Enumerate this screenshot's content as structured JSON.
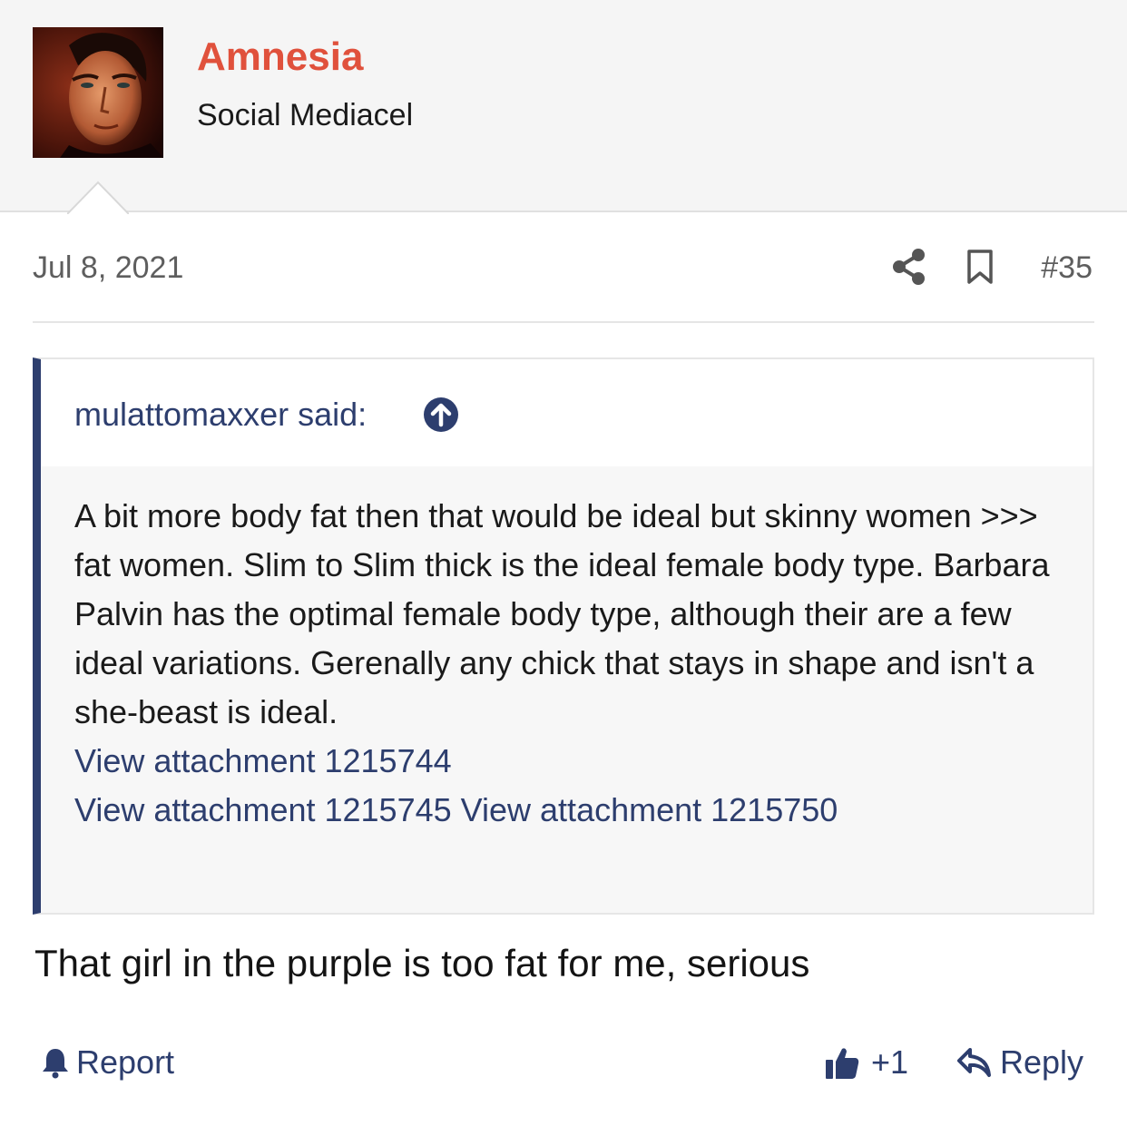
{
  "author": {
    "name": "Amnesia",
    "title": "Social Mediacel"
  },
  "post": {
    "date": "Jul 8, 2021",
    "number": "#35",
    "share_icon": "share-icon",
    "bookmark_icon": "bookmark-icon"
  },
  "quote": {
    "attribution": "mulattomaxxer said:",
    "up_icon": "arrow-up-circle-icon",
    "text": "A bit more body fat then that would be ideal but skinny women >>> fat women. Slim to Slim thick is the ideal female body type. Barbara Palvin has the optimal female body type, although their are a few ideal variations. Gerenally any chick that stays in shape and isn't a she-beast is ideal.",
    "attachments": [
      "View attachment 1215744",
      "View attachment 1215745",
      "View attachment 1215750"
    ]
  },
  "message": "That girl in the purple is too fat for me, serious",
  "actions": {
    "report_label": "Report",
    "like_label": "+1",
    "reply_label": "Reply"
  },
  "colors": {
    "username": "#e0513c",
    "link": "#2d3e6e",
    "quote_bar": "#2d3e6e"
  }
}
